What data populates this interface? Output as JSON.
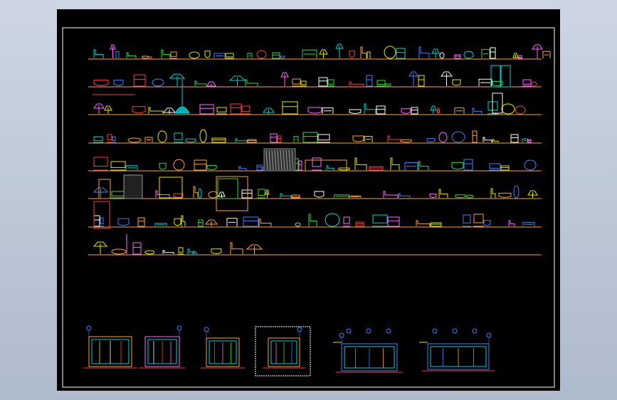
{
  "viewport": {
    "background_color": "#bfc9d8",
    "sheet_color": "#000000"
  },
  "drawing": {
    "border_color": "#ffffff",
    "baseline_color": "#ff9f3a",
    "shelf_rows": 8,
    "symbol_palette": [
      "#00d2d2",
      "#e6e600",
      "#ffffff",
      "#ff3b3b",
      "#ff66ff",
      "#33dd33",
      "#3f7fff",
      "#ff9f3a"
    ],
    "elevation_count": 6
  },
  "icons": {
    "lamp": "floor-lamp-icon",
    "chandelier": "chandelier-icon",
    "mirror": "mirror-icon",
    "bed": "bed-icon",
    "wardrobe": "wardrobe-icon",
    "sofa": "sofa-icon",
    "door": "door-icon"
  }
}
